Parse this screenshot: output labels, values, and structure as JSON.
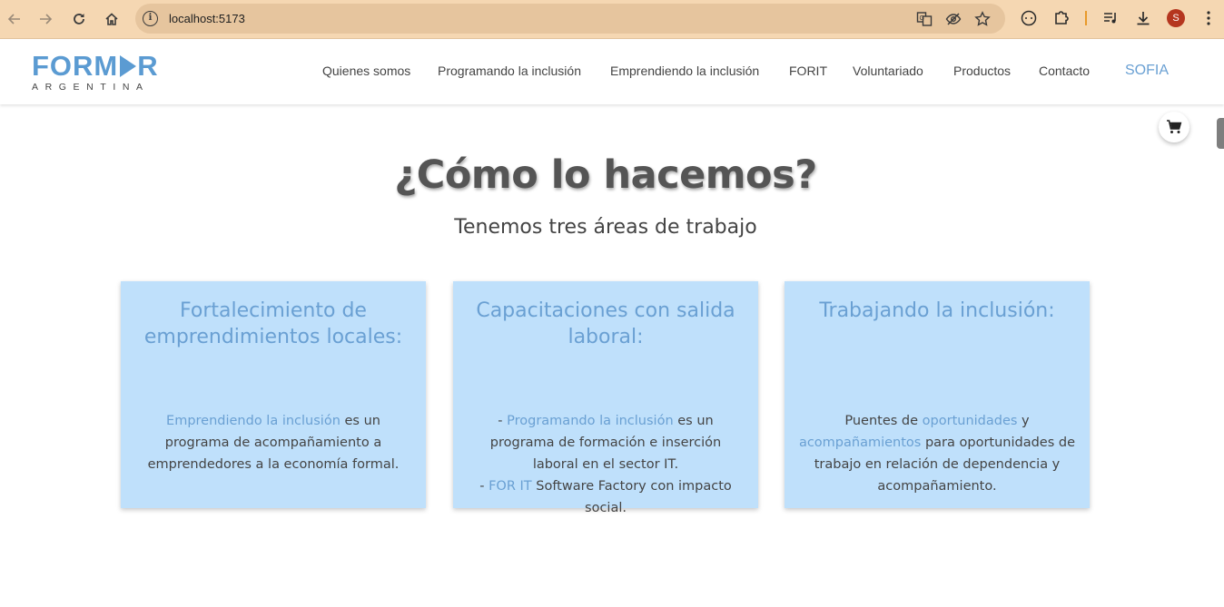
{
  "browser": {
    "url": "localhost:5173",
    "avatar_letter": "S",
    "icons": [
      "back-icon",
      "forward-icon",
      "reload-icon",
      "home-icon",
      "site-info-icon",
      "translate-icon",
      "eye-off-icon",
      "bookmark-star-icon",
      "extension-circle-icon",
      "puzzle-icon",
      "media-queue-icon",
      "download-icon",
      "more-menu-icon"
    ]
  },
  "site": {
    "logo_main_left": "FORM",
    "logo_main_right": "R",
    "logo_sub": "ARGENTINA",
    "nav": [
      {
        "label": "Quienes somos"
      },
      {
        "label": "Programando la inclusión"
      },
      {
        "label": "Emprendiendo la inclusión"
      },
      {
        "label": "FORIT"
      },
      {
        "label": "Voluntariado"
      },
      {
        "label": "Productos"
      },
      {
        "label": "Contacto"
      },
      {
        "label": "SOFIA"
      }
    ],
    "accent_color": "#6aa0d3",
    "card_color": "#bfe0fb"
  },
  "main": {
    "title": "¿Cómo lo hacemos?",
    "subtitle": "Tenemos tres áreas de trabajo",
    "cards": [
      {
        "title": "Fortalecimiento de emprendimientos locales:",
        "p1_link": "Emprendiendo la inclusión",
        "p1_text": " es un programa de acompañamiento a emprendedores a la economía formal."
      },
      {
        "title": "Capacitaciones con salida laboral:",
        "l1_prefix": "- ",
        "l1_link": "Programando la inclusión",
        "l1_text": " es un programa de formación e inserción laboral en el sector IT.",
        "l2_prefix": "- ",
        "l2_link": "FOR IT",
        "l2_text": " Software Factory con impacto social."
      },
      {
        "title": "Trabajando la inclusión:",
        "t1": "Puentes de ",
        "link1": "oportunidades",
        "t2": " y ",
        "link2": "acompañamientos",
        "t3": " para oportunidades de trabajo en relación de dependencia y acompañamiento."
      }
    ]
  }
}
